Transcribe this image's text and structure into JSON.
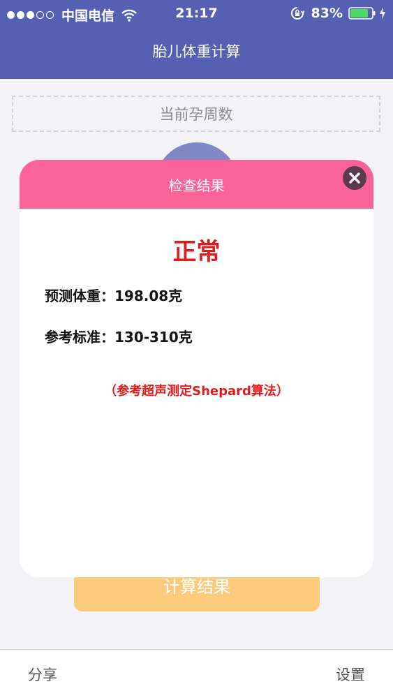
{
  "status_bar": {
    "carrier": "中国电信",
    "time": "21:17",
    "battery_percent": "83%",
    "battery_level": 0.83,
    "icons": [
      "signal-icon",
      "wifi-icon",
      "orientation-lock-icon",
      "battery-icon",
      "charging-icon"
    ]
  },
  "nav": {
    "title": "胎儿体重计算"
  },
  "form": {
    "weeks_label": "当前孕周数",
    "calculate_label": "计算结果"
  },
  "tab_bar": {
    "share_label": "分享",
    "settings_label": "设置"
  },
  "modal": {
    "title": "检查结果",
    "close_icon": "close-icon",
    "status": "正常",
    "weight_label": "预测体重：",
    "weight_value": "198.08克",
    "reference_label": "参考标准：",
    "reference_value": "130-310克",
    "note": "（参考超声测定Shepard算法）"
  },
  "colors": {
    "nav_bg": "#5660b3",
    "modal_header": "#f96397",
    "status_red": "#e21c1c",
    "button_orange": "#fbb951",
    "battery_green": "#4cd964",
    "close_bg": "#5a3b4e"
  }
}
